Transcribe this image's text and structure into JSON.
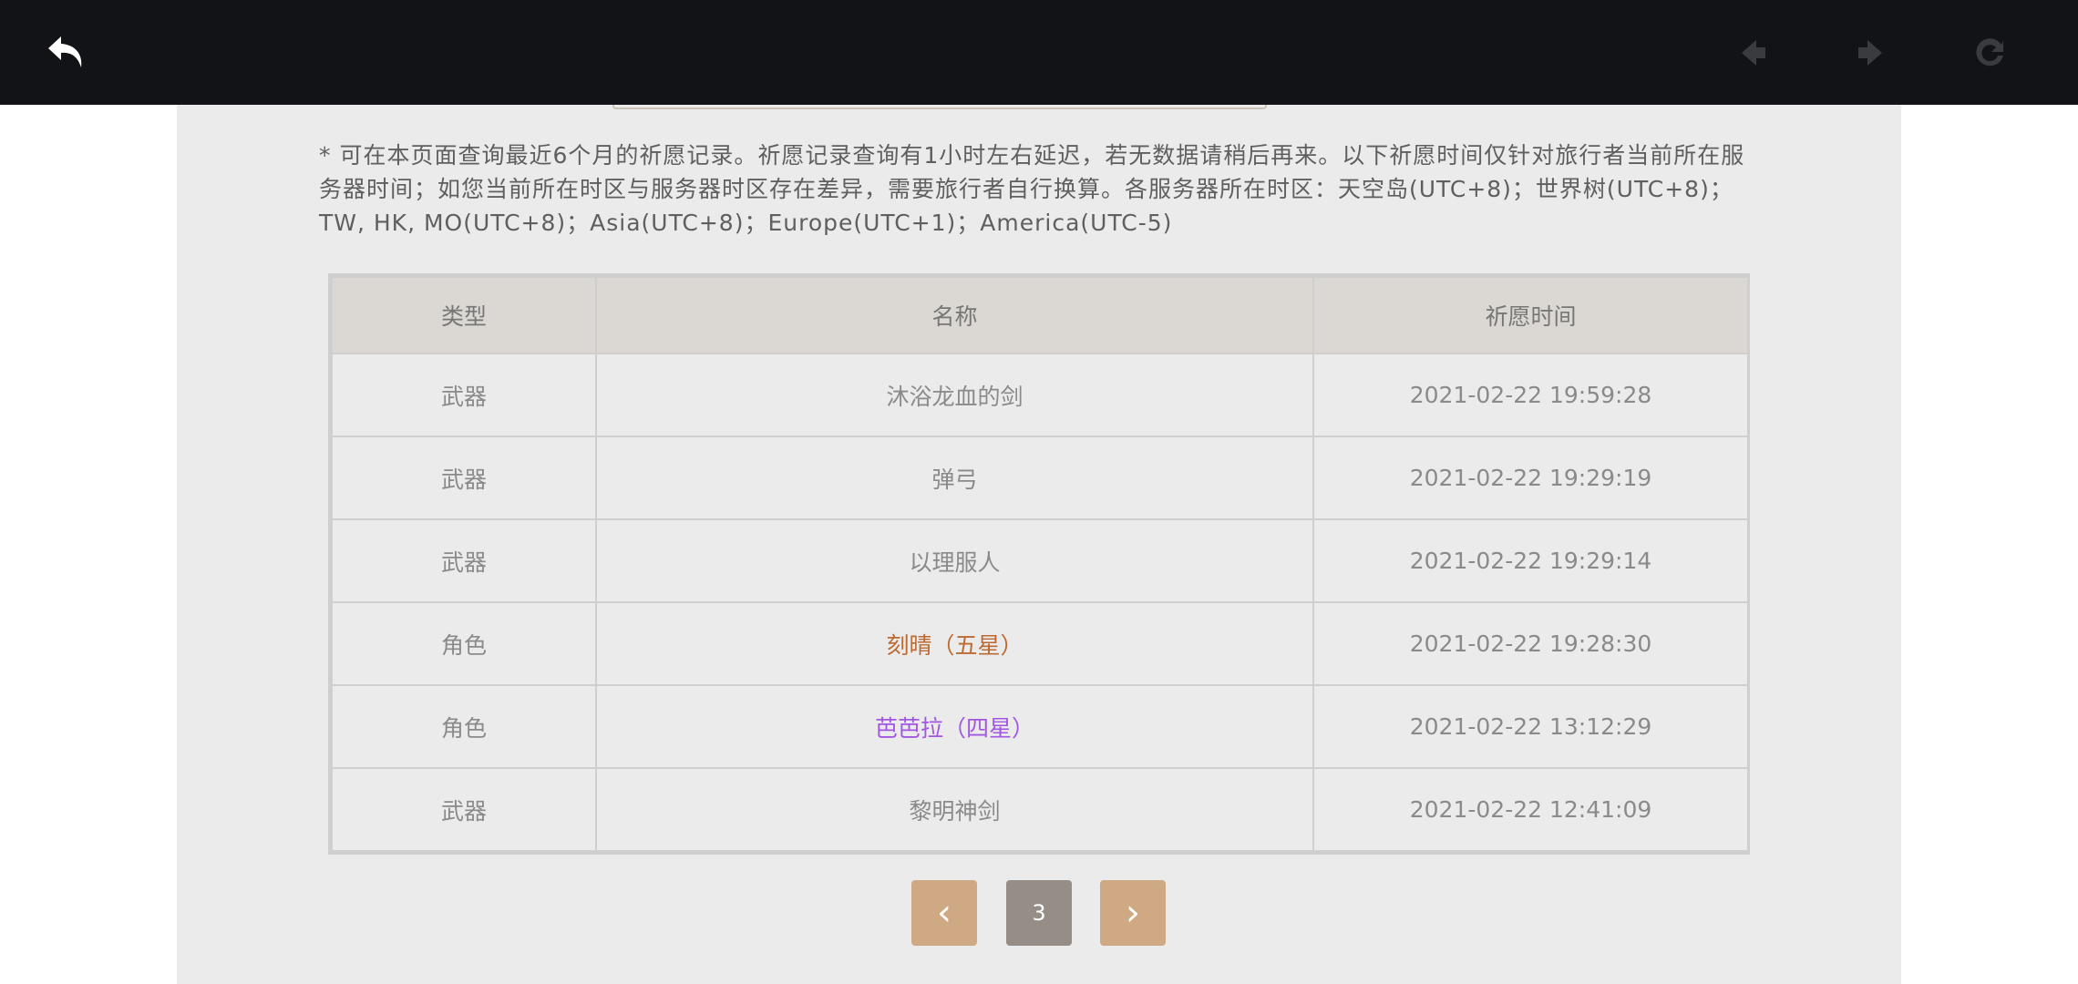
{
  "topbar": {
    "icons": [
      "back-icon",
      "prev-arrow-icon",
      "next-arrow-icon",
      "reload-icon"
    ]
  },
  "notice": "* 可在本页面查询最近6个月的祈愿记录。祈愿记录查询有1小时左右延迟，若无数据请稍后再来。以下祈愿时间仅针对旅行者当前所在服务器时间；如您当前所在时区与服务器时区存在差异，需要旅行者自行换算。各服务器所在时区：天空岛(UTC+8)；世界树(UTC+8)；TW, HK, MO(UTC+8)；Asia(UTC+8)；Europe(UTC+1)；America(UTC-5)",
  "table": {
    "headers": [
      "类型",
      "名称",
      "祈愿时间"
    ],
    "rows": [
      {
        "type": "武器",
        "name": "沐浴龙血的剑",
        "time": "2021-02-22 19:59:28"
      },
      {
        "type": "武器",
        "name": "弹弓",
        "time": "2021-02-22 19:29:19"
      },
      {
        "type": "武器",
        "name": "以理服人",
        "time": "2021-02-22 19:29:14"
      },
      {
        "type": "角色",
        "name": "刻晴（五星）",
        "time": "2021-02-22 19:28:30"
      },
      {
        "type": "角色",
        "name": "芭芭拉（四星）",
        "time": "2021-02-22 13:12:29"
      },
      {
        "type": "武器",
        "name": "黎明神剑",
        "time": "2021-02-22 12:41:09"
      }
    ]
  },
  "pager": {
    "prev": "‹",
    "current": "3",
    "next": "›"
  },
  "colors": {
    "five_star": "#bd6932",
    "four_star": "#a256e1",
    "normal": "#8a8a8a",
    "accent": "#cfa983",
    "current_page": "#958d86"
  }
}
